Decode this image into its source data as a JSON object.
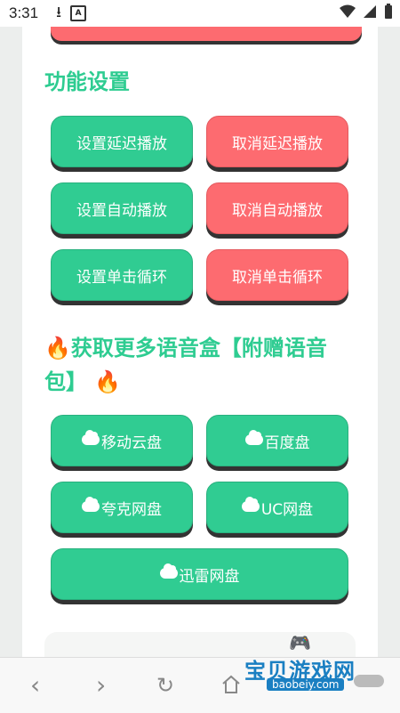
{
  "status_bar": {
    "time": "3:31",
    "a_icon": "A"
  },
  "sections": {
    "function_title": "功能设置",
    "more_title": "获取更多语音盒【附赠语音包】"
  },
  "buttons": {
    "set_delay": "设置延迟播放",
    "cancel_delay": "取消延迟播放",
    "set_auto": "设置自动播放",
    "cancel_auto": "取消自动播放",
    "set_single_loop": "设置单击循环",
    "cancel_single_loop": "取消单击循环",
    "mobile_cloud": "移动云盘",
    "baidu": "百度盘",
    "quark": "夸克网盘",
    "uc": "UC网盘",
    "xunlei": "迅雷网盘"
  },
  "watermark": {
    "text": "宝贝游戏网",
    "url": "baobeiy.com"
  },
  "colors": {
    "green": "#30cc92",
    "red": "#fd6b70",
    "title": "#2ecc91"
  }
}
